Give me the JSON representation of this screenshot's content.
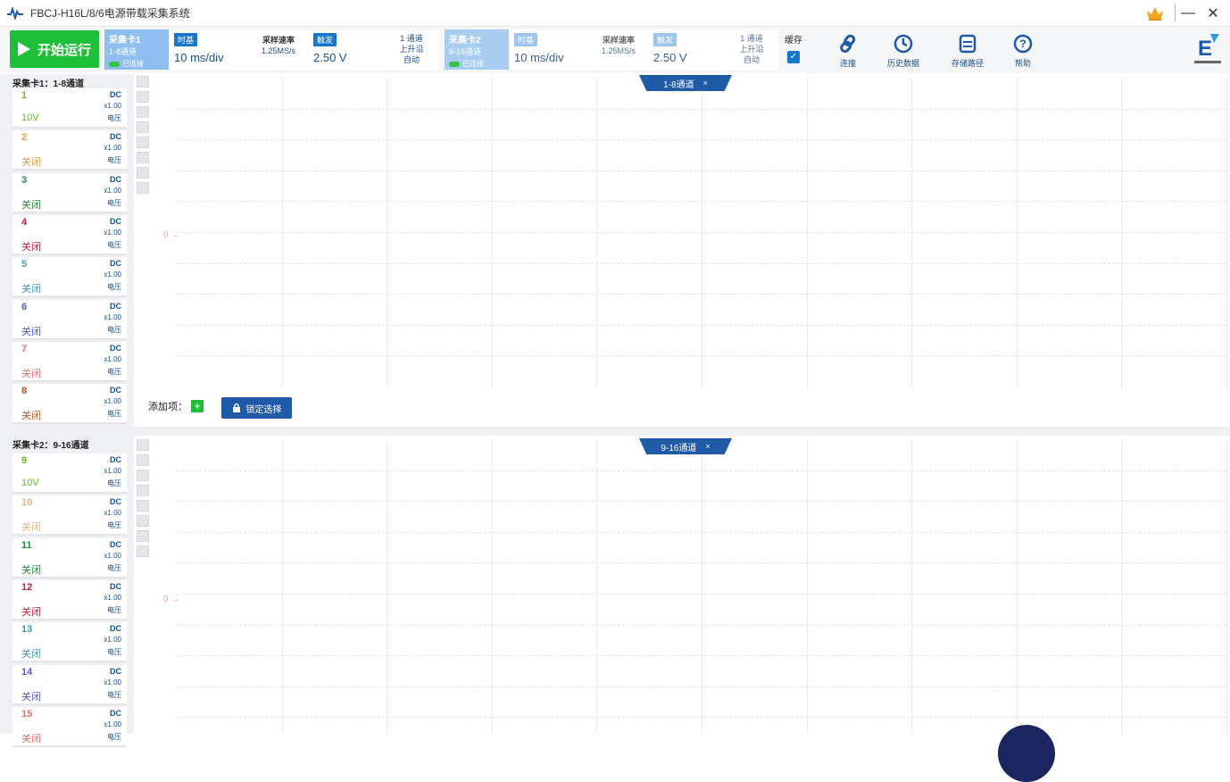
{
  "window": {
    "title": "FBCJ-H16L/8/6电源带载采集系统",
    "minimize": "—",
    "close": "✕"
  },
  "toolbar": {
    "start_label": "开始运行",
    "card1": {
      "head_title": "采集卡1",
      "head_sub": "1-8通道",
      "head_status": "已连接",
      "timebase_tag": "时基",
      "timebase_value": "10 ms/div",
      "sample_label": "采样速率",
      "sample_value": "1.25MS/s",
      "range_tag": "触发",
      "range_value": "2.50 V",
      "small1": "1 通道",
      "small2": "上升沿",
      "small3": "自动"
    },
    "card2": {
      "head_title": "采集卡2",
      "head_sub": "9-16通道",
      "head_status": "已连接",
      "timebase_tag": "时基",
      "timebase_value": "10 ms/div",
      "sample_label": "采样速率",
      "sample_value": "1.25MS/s",
      "range_tag": "触发",
      "range_value": "2.50 V",
      "small1": "1 通道",
      "small2": "上升沿",
      "small3": "自动"
    },
    "cache_label": "缓存",
    "cache_check": "✓",
    "tools": [
      {
        "label": "连接"
      },
      {
        "label": "历史数据"
      },
      {
        "label": "存储路径"
      },
      {
        "label": "帮助"
      }
    ]
  },
  "panel1": {
    "title": "采集卡1：1-8通道",
    "tab": "1-8通道",
    "tab_close": "×",
    "zero": "0",
    "add_label": "添加项：",
    "add_plus": "+",
    "lock_label": "锁定选择",
    "channels": [
      {
        "num": "1",
        "state": "10V",
        "dc": "DC",
        "x1": "x1.00",
        "volt": "电压",
        "color": "#5cc21f"
      },
      {
        "num": "2",
        "state": "关闭",
        "dc": "DC",
        "x1": "x1.00",
        "volt": "电压",
        "color": "#f09a3c"
      },
      {
        "num": "3",
        "state": "关闭",
        "dc": "DC",
        "x1": "x1.00",
        "volt": "电压",
        "color": "#1f8f3a"
      },
      {
        "num": "4",
        "state": "关闭",
        "dc": "DC",
        "x1": "x1.00",
        "volt": "电压",
        "color": "#c0203a"
      },
      {
        "num": "5",
        "state": "关闭",
        "dc": "DC",
        "x1": "x1.00",
        "volt": "电压",
        "color": "#3a9ac0"
      },
      {
        "num": "6",
        "state": "关闭",
        "dc": "DC",
        "x1": "x1.00",
        "volt": "电压",
        "color": "#4a5ad0"
      },
      {
        "num": "7",
        "state": "关闭",
        "dc": "DC",
        "x1": "x1.00",
        "volt": "电压",
        "color": "#f06a6a"
      },
      {
        "num": "8",
        "state": "关闭",
        "dc": "DC",
        "x1": "x1.00",
        "volt": "电压",
        "color": "#d0551a"
      }
    ]
  },
  "panel2": {
    "title": "采集卡2：9-16通道",
    "tab": "9-16通道",
    "tab_close": "×",
    "zero": "0",
    "channels": [
      {
        "num": "9",
        "state": "10V",
        "dc": "DC",
        "x1": "x1.00",
        "volt": "电压",
        "color": "#5cc21f"
      },
      {
        "num": "10",
        "state": "关闭",
        "dc": "DC",
        "x1": "x1.00",
        "volt": "电压",
        "color": "#f0b07a"
      },
      {
        "num": "11",
        "state": "关闭",
        "dc": "DC",
        "x1": "x1.00",
        "volt": "电压",
        "color": "#1f8f3a"
      },
      {
        "num": "12",
        "state": "关闭",
        "dc": "DC",
        "x1": "x1.00",
        "volt": "电压",
        "color": "#c0203a"
      },
      {
        "num": "13",
        "state": "关闭",
        "dc": "DC",
        "x1": "x1.00",
        "volt": "电压",
        "color": "#3a9ac0"
      },
      {
        "num": "14",
        "state": "关闭",
        "dc": "DC",
        "x1": "x1.00",
        "volt": "电压",
        "color": "#4a5ad0"
      },
      {
        "num": "15",
        "state": "关闭",
        "dc": "DC",
        "x1": "x1.00",
        "volt": "电压",
        "color": "#f06a6a"
      }
    ]
  }
}
